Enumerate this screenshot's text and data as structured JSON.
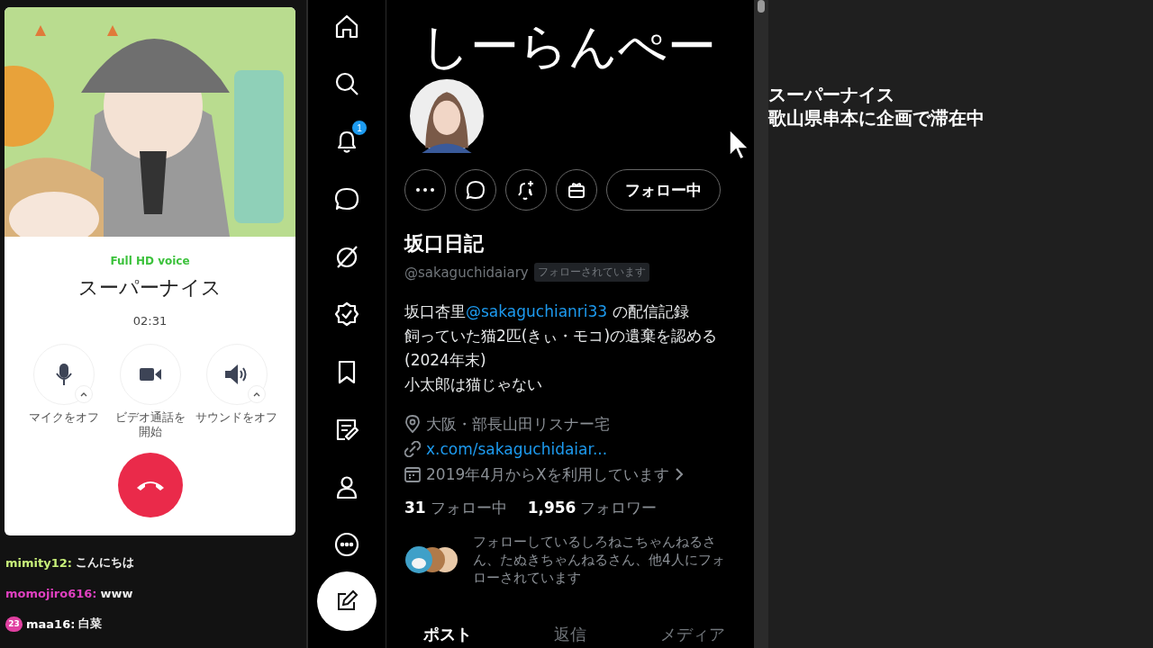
{
  "call": {
    "quality": "Full HD voice",
    "name": "スーパーナイス",
    "duration": "02:31",
    "controls": [
      {
        "kind": "mic",
        "label": "マイクをオフ",
        "expandable": true
      },
      {
        "kind": "video",
        "label": "ビデオ通話を開始",
        "expandable": false
      },
      {
        "kind": "sound",
        "label": "サウンドをオフ",
        "expandable": true
      }
    ]
  },
  "chat": [
    {
      "user": "mimity12:",
      "message": "こんにちは",
      "color": "#c8f07a"
    },
    {
      "user": "momojiro616:",
      "message": "www",
      "color": "#e040c0"
    },
    {
      "user": "maa16:",
      "message": "白菜",
      "color": "#ffffff",
      "badge": "23"
    }
  ],
  "nav": {
    "notification_count": "1"
  },
  "profile": {
    "header_title": "しーらんぺー",
    "follow_button": "フォロー中",
    "name": "坂口日記",
    "handle": "@sakaguchidaiary",
    "follows_you": "フォローされています",
    "bio": [
      [
        {
          "text": "坂口杏里"
        },
        {
          "link": "@sakaguchianri33"
        },
        {
          "text": " の配信記録"
        }
      ],
      [
        {
          "text": "飼っていた猫2匹(きぃ・モコ)の遺棄を認める(2024年末)"
        }
      ],
      [
        {
          "text": "小太郎は猫じゃない"
        }
      ]
    ],
    "location": "大阪・部長山田リスナー宅",
    "url": "x.com/sakaguchidaiar...",
    "joined": "2019年4月からXを利用しています",
    "following_count": "31",
    "following_label": "フォロー中",
    "followers_count": "1,956",
    "followers_label": "フォロワー",
    "followed_by": "フォローしているしろねこちゃんねるさん、たぬきちゃんねるさん、他4人にフォローされています",
    "tabs": [
      {
        "label": "ポスト",
        "selected": true
      },
      {
        "label": "返信",
        "selected": false
      },
      {
        "label": "メディア",
        "selected": false
      }
    ]
  },
  "overlay": {
    "lines": [
      "スーパーナイス",
      "歌山県串本に企画で滞在中"
    ]
  }
}
